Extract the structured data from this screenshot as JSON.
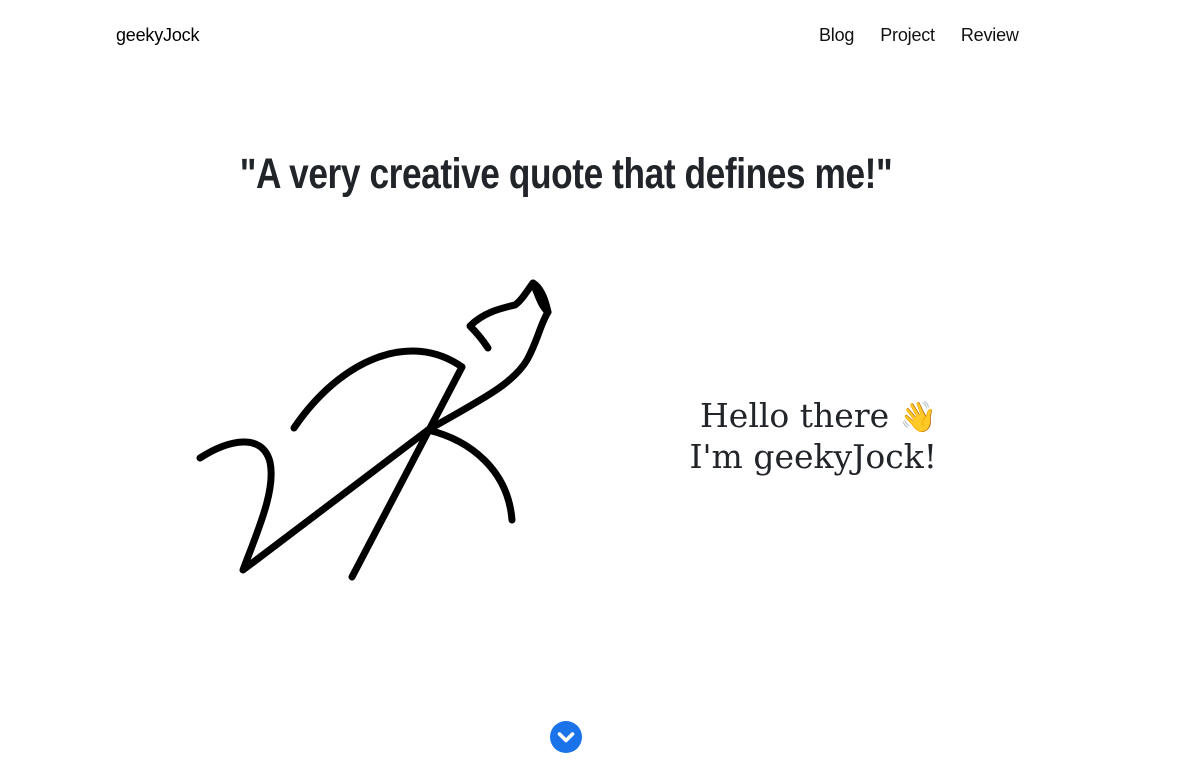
{
  "navbar": {
    "brand": "geekyJock",
    "links": [
      "Blog",
      "Project",
      "Review"
    ]
  },
  "hero": {
    "quote": "\"A very creative quote that defines me!\"",
    "greeting_line1": "Hello there",
    "greeting_emoji": "👋",
    "greeting_line2": "I'm geekyJock!"
  },
  "icons": {
    "logo": "signature-cat-logo",
    "scroll": "chevron-down-circle-icon"
  },
  "colors": {
    "accent": "#1a73e8",
    "text": "#212529"
  }
}
